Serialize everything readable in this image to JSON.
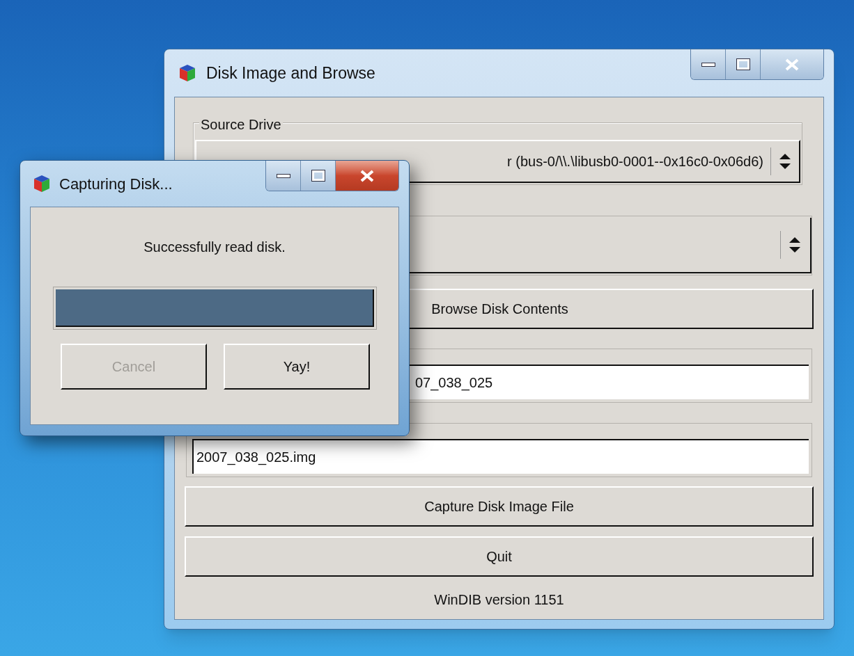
{
  "main_window": {
    "title": "Disk Image and Browse",
    "active": false,
    "source_drive": {
      "label": "Source Drive",
      "value": "r (bus-0/\\\\.\\libusb0-0001--0x16c0-0x06d6)"
    },
    "browse_button": "Browse Disk Contents",
    "name_field": {
      "value": "07_038_025"
    },
    "file_field": {
      "value": "2007_038_025.img"
    },
    "capture_button": "Capture Disk Image File",
    "quit_button": "Quit",
    "version": "WinDIB version 1151"
  },
  "dialog": {
    "title": "Capturing Disk...",
    "active": true,
    "message": "Successfully read disk.",
    "progress": {
      "level": 1
    },
    "buttons": [
      {
        "label": "Cancel",
        "disabled": true
      },
      {
        "label": "Yay!",
        "disabled": false
      }
    ]
  }
}
